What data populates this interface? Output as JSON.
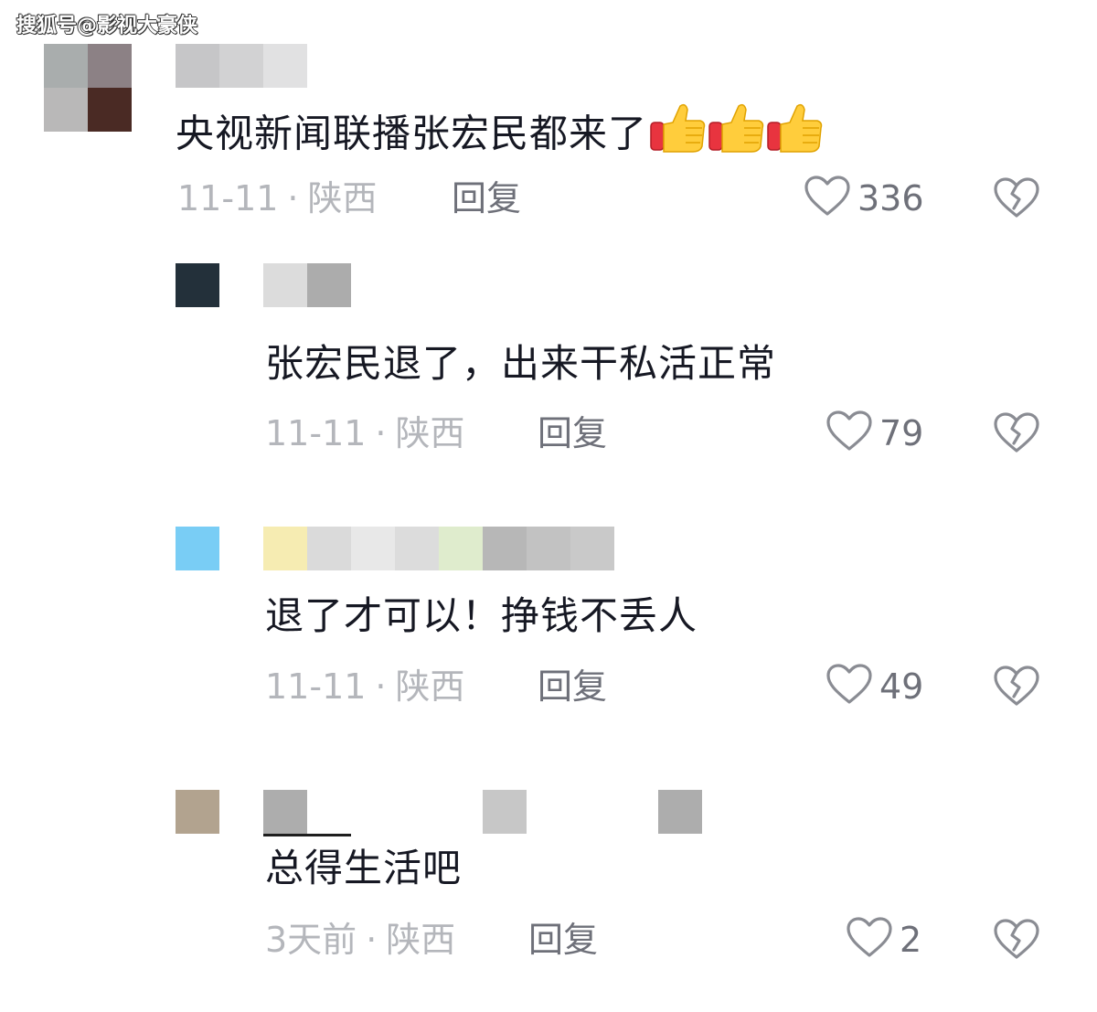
{
  "watermark": "搜狐号@影视大豪侠",
  "comments": [
    {
      "text": "央视新闻联播张宏民都来了",
      "emoji": "thumbs-up-icon x3",
      "date": "11-11",
      "location": "陕西",
      "reply_label": "回复",
      "likes": "336"
    },
    {
      "text": "张宏民退了，出来干私活正常",
      "date": "11-11",
      "location": "陕西",
      "reply_label": "回复",
      "likes": "79"
    },
    {
      "text": "退了才可以！挣钱不丢人",
      "date": "11-11",
      "location": "陕西",
      "reply_label": "回复",
      "likes": "49"
    },
    {
      "text": "总得生活吧",
      "date": "3天前",
      "location": "陕西",
      "reply_label": "回复",
      "likes": "2"
    }
  ],
  "separator": "·",
  "colors": {
    "text": "#161823",
    "meta": "#b4b6bb",
    "action": "#6e7079",
    "icon": "#8a8c93"
  }
}
